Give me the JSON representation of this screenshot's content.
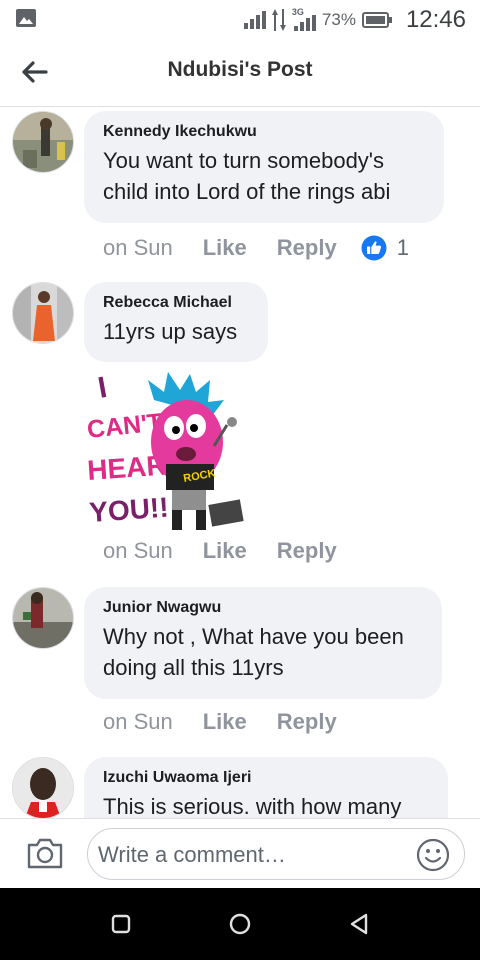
{
  "status_bar": {
    "network": "3G",
    "battery_percent": "73%",
    "time": "12:46",
    "icons": [
      "image-icon",
      "signal-icon",
      "data-transfer-icon",
      "signal-icon",
      "battery-icon"
    ]
  },
  "header": {
    "title": "Ndubisi's Post"
  },
  "comments": [
    {
      "author": "Kennedy Ikechukwu",
      "lines": [
        "You want to turn somebody's",
        "child into Lord of the rings abi"
      ],
      "time": "on Sun",
      "like_label": "Like",
      "reply_label": "Reply",
      "reaction_count": "1"
    },
    {
      "author": "Rebecca Michael",
      "lines": [
        "11yrs up says"
      ],
      "time": "on Sun",
      "like_label": "Like",
      "reply_label": "Reply",
      "sticker": {
        "words": [
          "I",
          "CAN'T",
          "HEAR",
          "YOU!!"
        ],
        "shirt_text": "ROCK"
      }
    },
    {
      "author": "Junior Nwagwu",
      "lines": [
        "Why not , What have you been",
        "doing all this 11yrs"
      ],
      "time": "on Sun",
      "like_label": "Like",
      "reply_label": "Reply"
    },
    {
      "author": "Izuchi Uwaoma Ijeri",
      "lines": [
        "This is serious. with how many"
      ]
    }
  ],
  "composer": {
    "placeholder": "Write a comment…"
  },
  "colors": {
    "like_blue": "#1877f2",
    "bubble_gray": "#f0f2f5",
    "action_gray": "#90949c"
  }
}
